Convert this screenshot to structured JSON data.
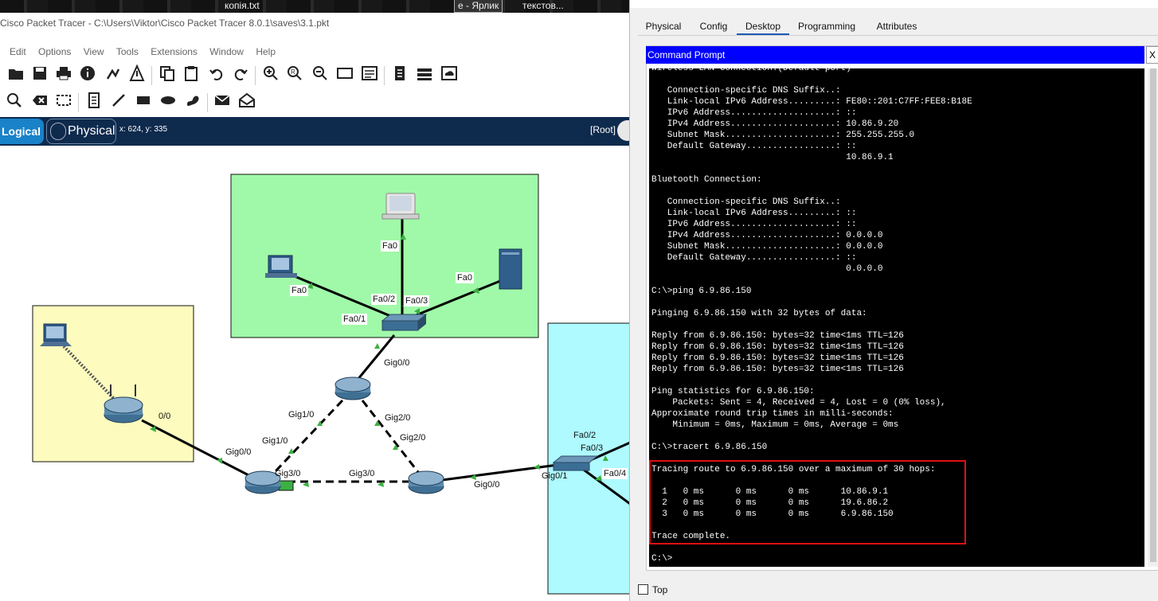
{
  "taskbar": {
    "items": [
      "копія.txt",
      "е - Ярлик",
      "текстов..."
    ]
  },
  "window": {
    "title": "Cisco Packet Tracer - C:\\Users\\Viktor\\Cisco Packet Tracer 8.0.1\\saves\\3.1.pkt"
  },
  "menu": [
    "Edit",
    "Options",
    "View",
    "Tools",
    "Extensions",
    "Window",
    "Help"
  ],
  "workspace": {
    "logical_label": "Logical",
    "physical_label": "Physical",
    "cursor_readout": "x: 624, y: 335",
    "root_label": "[Root]"
  },
  "areas": {
    "green": "#a0f9a8",
    "yellow": "#fdfcbe",
    "cyan": "#aefaff"
  },
  "port_labels": {
    "pc_top_fa0": "Fa0",
    "pc_left_fa0": "Fa0",
    "server_fa0": "Fa0",
    "sw_fa0_1": "Fa0/1",
    "sw_fa0_2": "Fa0/2",
    "sw_fa0_3": "Fa0/3",
    "sw_gig0_0": "Gig0/0",
    "r_top_gig1_0": "Gig1/0",
    "r_top_gig2_0": "Gig2/0",
    "r_left_gig1_0": "Gig1/0",
    "r_right_gig2_0": "Gig2/0",
    "r_left_gig3_0": "Gig3/0",
    "r_right_gig3_0": "Gig3/0",
    "r_left_gig0_0": "Gig0/0",
    "wr_0_0": "0/0",
    "r_right_gig0_0": "Gig0/0",
    "sw2_gig0_1": "Gig0/1",
    "sw2_fa0_2": "Fa0/2",
    "sw2_fa0_3": "Fa0/3",
    "sw2_fa0_4": "Fa0/4"
  },
  "panel": {
    "tabs": [
      "Physical",
      "Config",
      "Desktop",
      "Programming",
      "Attributes"
    ],
    "active_tab": "Desktop",
    "command_prompt_title": "Command Prompt",
    "close_label": "X",
    "top_label": "Top",
    "terminal_lines": [
      "Wireless LAN Connection:(Default port)",
      "",
      "   Connection-specific DNS Suffix..:",
      "   Link-local IPv6 Address.........: FE80::201:C7FF:FEE8:B18E",
      "   IPv6 Address....................: ::",
      "   IPv4 Address....................: 10.86.9.20",
      "   Subnet Mask.....................: 255.255.255.0",
      "   Default Gateway.................: ::",
      "                                     10.86.9.1",
      "",
      "Bluetooth Connection:",
      "",
      "   Connection-specific DNS Suffix..:",
      "   Link-local IPv6 Address.........: ::",
      "   IPv6 Address....................: ::",
      "   IPv4 Address....................: 0.0.0.0",
      "   Subnet Mask.....................: 0.0.0.0",
      "   Default Gateway.................: ::",
      "                                     0.0.0.0",
      "",
      "C:\\>ping 6.9.86.150",
      "",
      "Pinging 6.9.86.150 with 32 bytes of data:",
      "",
      "Reply from 6.9.86.150: bytes=32 time<1ms TTL=126",
      "Reply from 6.9.86.150: bytes=32 time<1ms TTL=126",
      "Reply from 6.9.86.150: bytes=32 time<1ms TTL=126",
      "Reply from 6.9.86.150: bytes=32 time<1ms TTL=126",
      "",
      "Ping statistics for 6.9.86.150:",
      "    Packets: Sent = 4, Received = 4, Lost = 0 (0% loss),",
      "Approximate round trip times in milli-seconds:",
      "    Minimum = 0ms, Maximum = 0ms, Average = 0ms",
      "",
      "C:\\>tracert 6.9.86.150",
      "",
      "Tracing route to 6.9.86.150 over a maximum of 30 hops:",
      "",
      "  1   0 ms      0 ms      0 ms      10.86.9.1",
      "  2   0 ms      0 ms      0 ms      19.6.86.2",
      "  3   0 ms      0 ms      0 ms      6.9.86.150",
      "",
      "Trace complete.",
      "",
      "C:\\>"
    ]
  }
}
